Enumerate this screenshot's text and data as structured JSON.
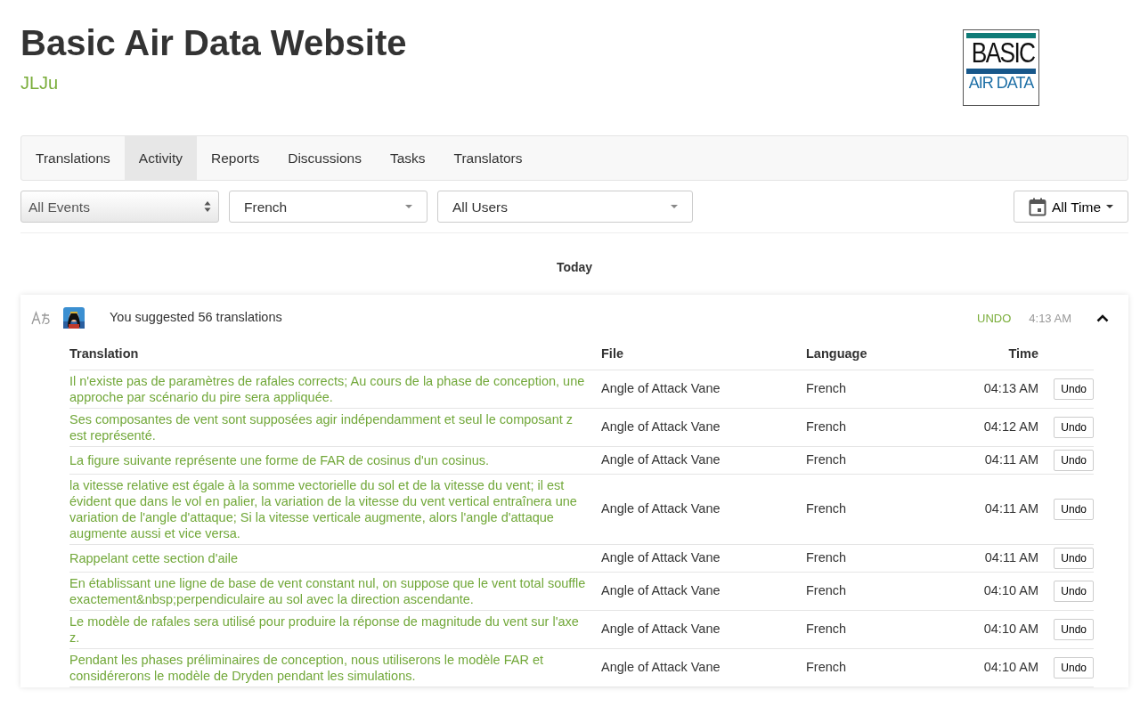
{
  "header": {
    "title": "Basic Air Data Website",
    "subtitle": "JLJu",
    "logo": {
      "top": "BASIC",
      "bottom": "AIR DATA"
    }
  },
  "tabs": [
    {
      "label": "Translations",
      "selected": false
    },
    {
      "label": "Activity",
      "selected": true
    },
    {
      "label": "Reports",
      "selected": false
    },
    {
      "label": "Discussions",
      "selected": false
    },
    {
      "label": "Tasks",
      "selected": false
    },
    {
      "label": "Translators",
      "selected": false
    }
  ],
  "filters": [
    {
      "kind": "select",
      "value": "All Events"
    },
    {
      "kind": "dropdown",
      "value": "French"
    },
    {
      "kind": "dropdown",
      "value": "All Users"
    }
  ],
  "time_filter": "All Time",
  "day_heading": "Today",
  "event": {
    "summary": "You suggested 56 translations",
    "undo": "UNDO",
    "time": "4:13 AM",
    "expanded": true,
    "table": {
      "columns": [
        "Translation",
        "File",
        "Language",
        "Time"
      ],
      "rows": [
        {
          "translation": "Il n'existe pas de paramètres de rafales corrects; Au cours de la phase de conception, une approche par scénario du pire sera appliquée.",
          "file": "Angle of Attack Vane",
          "language": "French",
          "time": "04:13 AM",
          "action": "Undo"
        },
        {
          "translation": "Ses composantes de vent sont supposées agir indépendamment et seul le composant z est représenté.",
          "file": "Angle of Attack Vane",
          "language": "French",
          "time": "04:12 AM",
          "action": "Undo"
        },
        {
          "translation": "La figure suivante représente une forme de FAR de cosinus d'un cosinus.",
          "file": "Angle of Attack Vane",
          "language": "French",
          "time": "04:11 AM",
          "action": "Undo"
        },
        {
          "translation": "la vitesse relative est égale à la somme vectorielle du sol et de la vitesse du vent; il est évident que dans le vol en palier, la variation de la vitesse du vent vertical entraînera une variation de l'angle d'attaque; Si la vitesse verticale augmente, alors l'angle d'attaque augmente aussi et vice versa.",
          "file": "Angle of Attack Vane",
          "language": "French",
          "time": "04:11 AM",
          "action": "Undo"
        },
        {
          "translation": "Rappelant cette section d'aile",
          "file": "Angle of Attack Vane",
          "language": "French",
          "time": "04:11 AM",
          "action": "Undo"
        },
        {
          "translation": "En établissant une ligne de base de vent constant nul, on suppose que le vent total souffle exactement&nbsp;perpendiculaire au sol avec la direction ascendante.",
          "file": "Angle of Attack Vane",
          "language": "French",
          "time": "04:10 AM",
          "action": "Undo"
        },
        {
          "translation": "Le modèle de rafales sera utilisé pour produire la réponse de magnitude du vent sur l'axe z.",
          "file": "Angle of Attack Vane",
          "language": "French",
          "time": "04:10 AM",
          "action": "Undo"
        },
        {
          "translation": "Pendant les phases préliminaires de conception, nous utiliserons le modèle FAR et considérerons le modèle de Dryden pendant les simulations.",
          "file": "Angle of Attack Vane",
          "language": "French",
          "time": "04:10 AM",
          "action": "Undo"
        }
      ]
    }
  }
}
